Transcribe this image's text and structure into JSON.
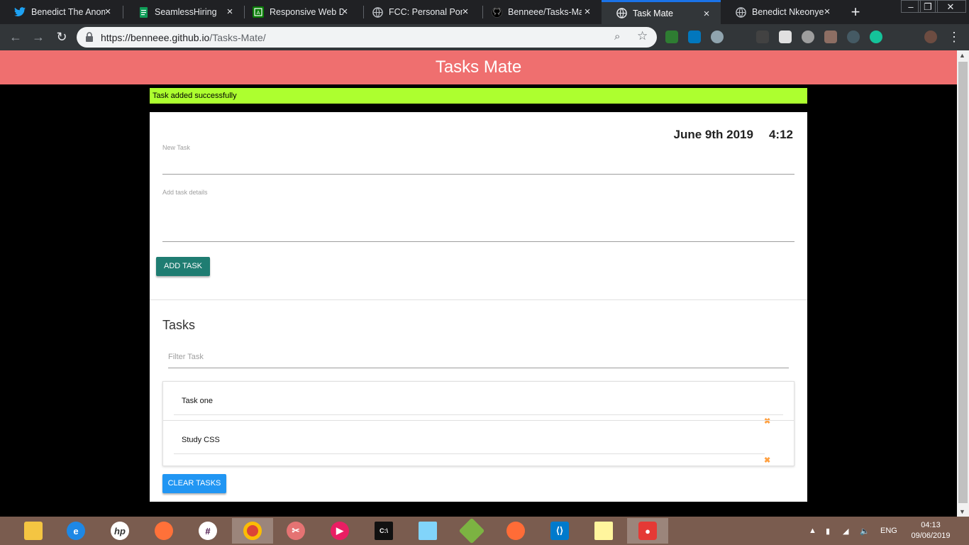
{
  "browser": {
    "tabs": [
      {
        "title": "Benedict The Anom",
        "icon": "twitter-icon",
        "color": "#1da1f2"
      },
      {
        "title": "SeamlessHiring",
        "icon": "document-icon",
        "color": "#0f9d58"
      },
      {
        "title": "Responsive Web De",
        "icon": "code-icon",
        "color": "#0a7e07"
      },
      {
        "title": "FCC: Personal Portf",
        "icon": "globe-icon",
        "color": "#bdc1c6"
      },
      {
        "title": "Benneee/Tasks-Mat",
        "icon": "github-icon",
        "color": "#000000"
      },
      {
        "title": "Task Mate",
        "icon": "globe-icon",
        "color": "#bdc1c6"
      },
      {
        "title": "Benedict Nkeonye",
        "icon": "globe-icon",
        "color": "#bdc1c6"
      }
    ],
    "active_tab_index": 5,
    "url_host": "https://benneee.github.io",
    "url_path": "/Tasks-Mate/"
  },
  "app": {
    "title": "Tasks Mate",
    "alert": "Task added successfully",
    "date": "June 9th 2019",
    "time": "4:12",
    "new_task_label": "New Task",
    "details_label": "Add task details",
    "add_button": "ADD TASK",
    "tasks_heading": "Tasks",
    "filter_placeholder": "Filter Task",
    "tasks": [
      {
        "name": "Task one",
        "delete_icon": "close-icon"
      },
      {
        "name": "Study CSS",
        "delete_icon": "close-icon"
      }
    ],
    "clear_button": "CLEAR TASKS",
    "colors": {
      "header": "#ef6f6f",
      "alert": "#adff2f",
      "add_button": "#1f7d72",
      "clear_button": "#2196f3",
      "delete_icon": "#ffa040"
    }
  },
  "taskbar": {
    "language": "ENG",
    "clock_time": "04:13",
    "clock_date": "09/06/2019"
  }
}
